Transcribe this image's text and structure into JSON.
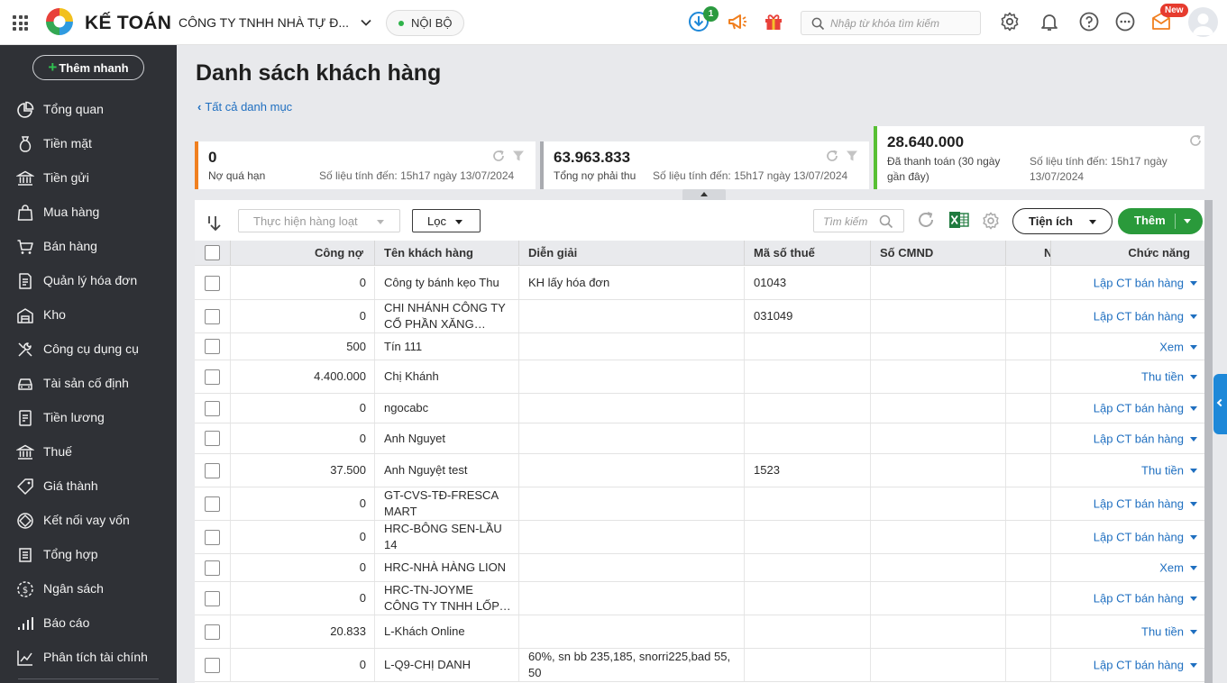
{
  "header": {
    "app_name": "KẾ TOÁN",
    "company": "CÔNG TY TNHH NHÀ TỰ Đ...",
    "scope": "NỘI BỘ",
    "download_badge": "1",
    "search_placeholder": "Nhập từ khóa tìm kiếm",
    "new_badge": "New"
  },
  "sidebar": {
    "quick_add": "Thêm nhanh",
    "items": [
      {
        "label": "Tổng quan",
        "icon": "dashboard-icon"
      },
      {
        "label": "Tiền mặt",
        "icon": "cash-bag-icon"
      },
      {
        "label": "Tiền gửi",
        "icon": "bank-icon"
      },
      {
        "label": "Mua hàng",
        "icon": "shopping-bag-icon"
      },
      {
        "label": "Bán hàng",
        "icon": "cart-icon"
      },
      {
        "label": "Quản lý hóa đơn",
        "icon": "invoice-icon"
      },
      {
        "label": "Kho",
        "icon": "warehouse-icon"
      },
      {
        "label": "Công cụ dụng cụ",
        "icon": "tools-icon"
      },
      {
        "label": "Tài sản cố định",
        "icon": "car-icon"
      },
      {
        "label": "Tiền lương",
        "icon": "payroll-icon"
      },
      {
        "label": "Thuế",
        "icon": "tax-icon"
      },
      {
        "label": "Giá thành",
        "icon": "price-tag-icon"
      },
      {
        "label": "Kết nối vay vốn",
        "icon": "loan-icon"
      },
      {
        "label": "Tổng hợp",
        "icon": "summary-icon"
      },
      {
        "label": "Ngân sách",
        "icon": "budget-icon"
      },
      {
        "label": "Báo cáo",
        "icon": "report-icon"
      },
      {
        "label": "Phân tích tài chính",
        "icon": "analysis-icon"
      }
    ]
  },
  "page": {
    "title": "Danh sách khách hàng",
    "back_link": "Tất cả danh mục"
  },
  "cards": [
    {
      "amount": "0",
      "caption": "Nợ quá hạn",
      "as_of": "Số liệu tính đến: 15h17 ngày 13/07/2024",
      "color": "#f07f1f"
    },
    {
      "amount": "63.963.833",
      "caption": "Tổng nợ phải thu",
      "as_of": "Số liệu tính đến: 15h17 ngày 13/07/2024",
      "color": "#a9abb0"
    },
    {
      "amount": "28.640.000",
      "caption_line1": "Đã thanh toán (30 ngày",
      "caption_line2": "gần đây)",
      "as_of_line1": "Số liệu tính đến: 15h17 ngày",
      "as_of_line2": "13/07/2024",
      "color": "#58c034"
    }
  ],
  "toolbar": {
    "bulk_action": "Thực hiện hàng loạt",
    "filter": "Lọc",
    "search_placeholder": "Tìm kiếm",
    "utilities": "Tiện ích",
    "add": "Thêm"
  },
  "table": {
    "columns": [
      "Công nợ",
      "Tên khách hàng",
      "Diễn giải",
      "Mã số thuế",
      "Số CMND",
      "N",
      "Chức năng"
    ],
    "rows": [
      {
        "debt": "0",
        "name": "Công ty bánh kẹo Thu",
        "desc": "KH lấy hóa đơn",
        "tax": "01043",
        "id": "",
        "action": "Lập CT bán hàng"
      },
      {
        "debt": "0",
        "name": "CHI NHÁNH CÔNG TY CỔ PHẦN XĂNG DẦU...",
        "desc": "",
        "tax": "031049",
        "id": "",
        "action": "Lập CT bán hàng"
      },
      {
        "debt": "500",
        "name": "Tín 111",
        "desc": "",
        "tax": "",
        "id": "",
        "action": "Xem"
      },
      {
        "debt": "4.400.000",
        "name": "Chị Khánh",
        "desc": "",
        "tax": "",
        "id": "",
        "action": "Thu tiền"
      },
      {
        "debt": "0",
        "name": "ngocabc",
        "desc": "",
        "tax": "",
        "id": "",
        "action": "Lập CT bán hàng"
      },
      {
        "debt": "0",
        "name": "Anh Nguyet",
        "desc": "",
        "tax": "",
        "id": "",
        "action": "Lập CT bán hàng"
      },
      {
        "debt": "37.500",
        "name": "Anh Nguyệt test",
        "desc": "",
        "tax": "1523",
        "id": "",
        "action": "Thu tiền"
      },
      {
        "debt": "0",
        "name": "GT-CVS-TĐ-FRESCA MART",
        "desc": "",
        "tax": "",
        "id": "",
        "action": "Lập CT bán hàng"
      },
      {
        "debt": "0",
        "name": "HRC-BÔNG SEN-LẦU 14",
        "desc": "",
        "tax": "",
        "id": "",
        "action": "Lập CT bán hàng"
      },
      {
        "debt": "0",
        "name": "HRC-NHÀ HÀNG LION",
        "desc": "",
        "tax": "",
        "id": "",
        "action": "Xem"
      },
      {
        "debt": "0",
        "name": "HRC-TN-JOYME CÔNG TY TNHH LỐP XE H.A...",
        "desc": "",
        "tax": "",
        "id": "",
        "action": "Lập CT bán hàng"
      },
      {
        "debt": "20.833",
        "name": "L-Khách Online",
        "desc": "",
        "tax": "",
        "id": "",
        "action": "Thu tiền"
      },
      {
        "debt": "0",
        "name": "L-Q9-CHỊ DANH",
        "desc": "60%, sn bb 235,185, snorri225,bad 55, 50",
        "tax": "",
        "id": "",
        "action": "Lập CT bán hàng"
      }
    ]
  }
}
